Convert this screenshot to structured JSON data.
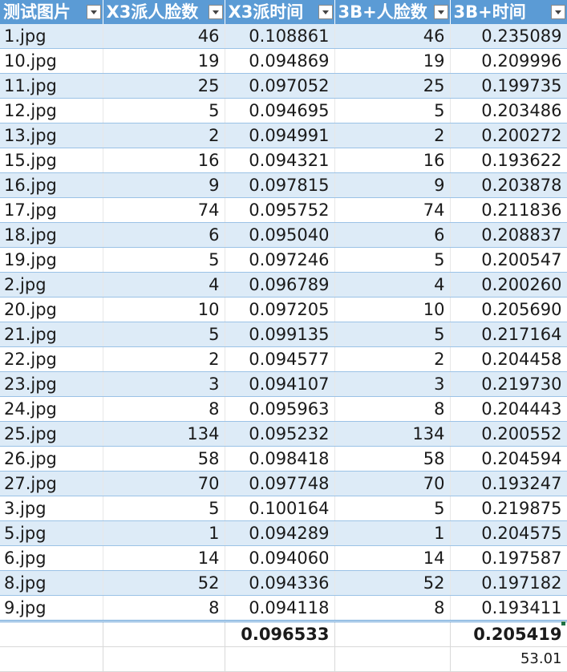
{
  "headers": [
    "测试图片",
    "X3派人脸数",
    "X3派时间",
    "3B+人脸数",
    "3B+时间"
  ],
  "rows": [
    [
      "1.jpg",
      "46",
      "0.108861",
      "46",
      "0.235089"
    ],
    [
      "10.jpg",
      "19",
      "0.094869",
      "19",
      "0.209996"
    ],
    [
      "11.jpg",
      "25",
      "0.097052",
      "25",
      "0.199735"
    ],
    [
      "12.jpg",
      "5",
      "0.094695",
      "5",
      "0.203486"
    ],
    [
      "13.jpg",
      "2",
      "0.094991",
      "2",
      "0.200272"
    ],
    [
      "15.jpg",
      "16",
      "0.094321",
      "16",
      "0.193622"
    ],
    [
      "16.jpg",
      "9",
      "0.097815",
      "9",
      "0.203878"
    ],
    [
      "17.jpg",
      "74",
      "0.095752",
      "74",
      "0.211836"
    ],
    [
      "18.jpg",
      "6",
      "0.095040",
      "6",
      "0.208837"
    ],
    [
      "19.jpg",
      "5",
      "0.097246",
      "5",
      "0.200547"
    ],
    [
      "2.jpg",
      "4",
      "0.096789",
      "4",
      "0.200260"
    ],
    [
      "20.jpg",
      "10",
      "0.097205",
      "10",
      "0.205690"
    ],
    [
      "21.jpg",
      "5",
      "0.099135",
      "5",
      "0.217164"
    ],
    [
      "22.jpg",
      "2",
      "0.094577",
      "2",
      "0.204458"
    ],
    [
      "23.jpg",
      "3",
      "0.094107",
      "3",
      "0.219730"
    ],
    [
      "24.jpg",
      "8",
      "0.095963",
      "8",
      "0.204443"
    ],
    [
      "25.jpg",
      "134",
      "0.095232",
      "134",
      "0.200552"
    ],
    [
      "26.jpg",
      "58",
      "0.098418",
      "58",
      "0.204594"
    ],
    [
      "27.jpg",
      "70",
      "0.097748",
      "70",
      "0.193247"
    ],
    [
      "3.jpg",
      "5",
      "0.100164",
      "5",
      "0.219875"
    ],
    [
      "5.jpg",
      "1",
      "0.094289",
      "1",
      "0.204575"
    ],
    [
      "6.jpg",
      "14",
      "0.094060",
      "14",
      "0.197587"
    ],
    [
      "8.jpg",
      "52",
      "0.094336",
      "52",
      "0.197182"
    ],
    [
      "9.jpg",
      "8",
      "0.094118",
      "8",
      "0.193411"
    ]
  ],
  "summary": {
    "x3_time_avg": "0.096533",
    "pi3b_time_avg": "0.205419",
    "ratio": "53.01"
  },
  "icons": {
    "filter": "filter-dropdown-icon"
  },
  "colors": {
    "header": "#5b9bd5",
    "band": "#ddebf7",
    "border": "#9bc2e6",
    "selection": "#217346"
  }
}
